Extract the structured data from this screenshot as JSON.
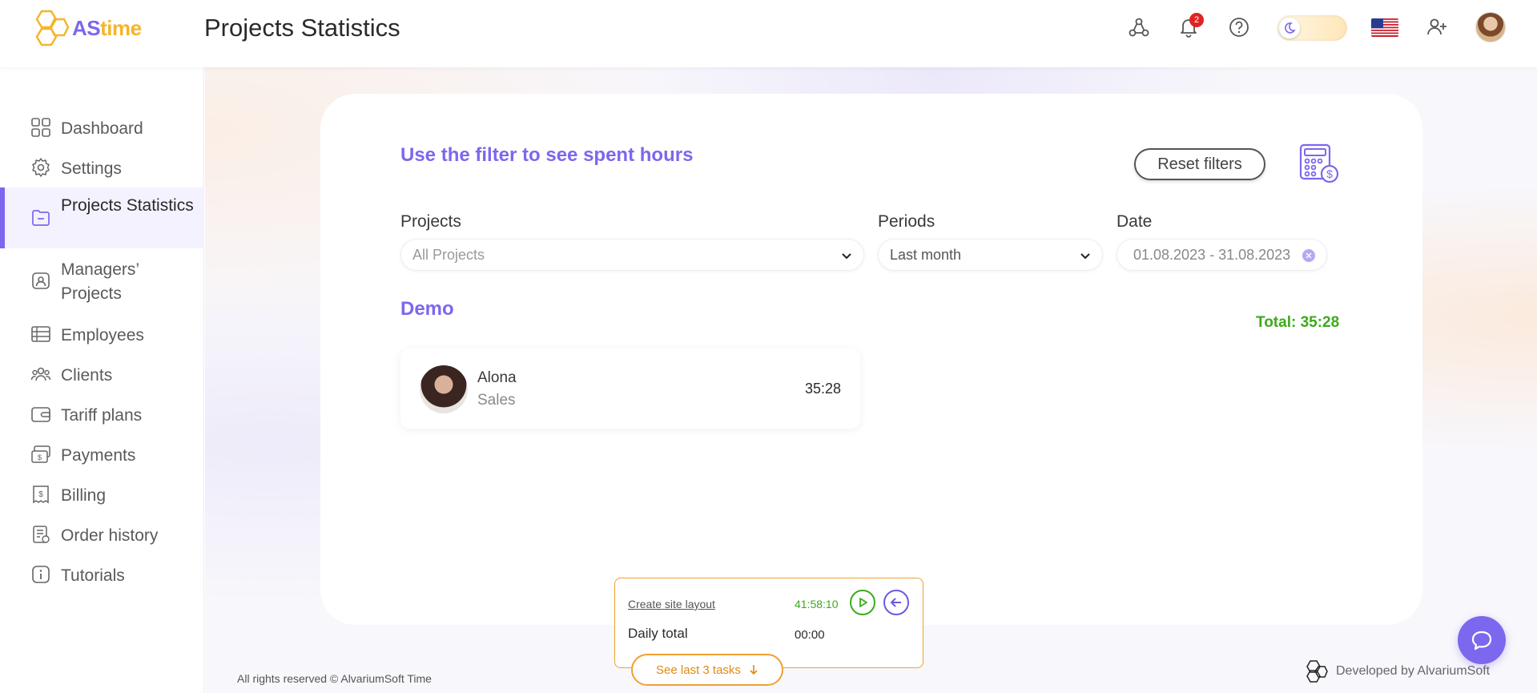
{
  "app": {
    "logo_as": "AS",
    "logo_time": "time",
    "page_title": "Projects Statistics"
  },
  "header": {
    "notification_count": "2"
  },
  "sidebar": {
    "items": [
      {
        "label": "Dashboard",
        "icon": "dashboard-icon"
      },
      {
        "label": "Settings",
        "icon": "gear-icon"
      },
      {
        "label": "Projects Statistics",
        "icon": "folder-icon",
        "active": true
      },
      {
        "label": "Managers’ Projects",
        "icon": "manager-icon"
      },
      {
        "label": "Employees",
        "icon": "employees-icon"
      },
      {
        "label": "Clients",
        "icon": "clients-icon"
      },
      {
        "label": "Tariff plans",
        "icon": "wallet-icon"
      },
      {
        "label": "Payments",
        "icon": "payments-icon"
      },
      {
        "label": "Billing",
        "icon": "billing-icon"
      },
      {
        "label": "Order history",
        "icon": "order-history-icon"
      },
      {
        "label": "Tutorials",
        "icon": "info-icon"
      }
    ]
  },
  "filters": {
    "heading": "Use the filter to see spent hours",
    "reset_label": "Reset filters",
    "projects_label": "Projects",
    "projects_placeholder": "All Projects",
    "periods_label": "Periods",
    "periods_value": "Last month",
    "date_label": "Date",
    "date_value": "01.08.2023 - 31.08.2023"
  },
  "group": {
    "title": "Demo",
    "total": "Total: 35:28",
    "employees": [
      {
        "name": "Alona",
        "role": "Sales",
        "time": "35:28"
      }
    ]
  },
  "timer": {
    "task_name": "Create site layout",
    "task_time": "41:58:10",
    "daily_label": "Daily total",
    "daily_value": "00:00",
    "see_last_label": "See last 3 tasks"
  },
  "footer": {
    "copyright": "All rights reserved © AlvariumSoft Time",
    "developed_by": "Developed by AlvariumSoft"
  },
  "colors": {
    "accent": "#7b68ee",
    "total_green": "#3cab1a",
    "timer_orange": "#f0a030"
  }
}
